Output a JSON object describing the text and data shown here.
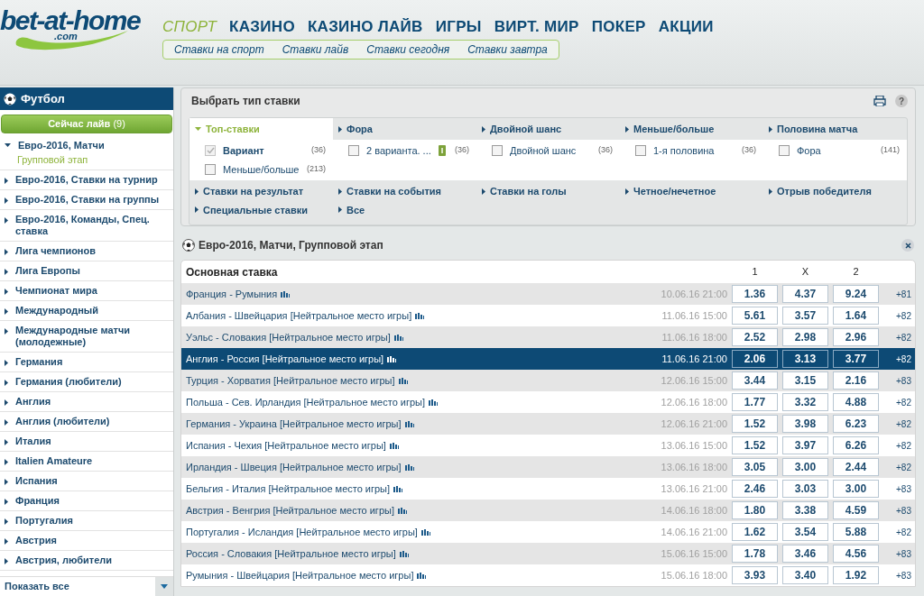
{
  "logo": {
    "name": "bet-at-home",
    "suffix": ".com"
  },
  "nav": [
    {
      "label": "СПОРТ",
      "selected": true
    },
    {
      "label": "КАЗИНО",
      "selected": false
    },
    {
      "label": "КАЗИНО ЛАЙВ",
      "selected": false
    },
    {
      "label": "ИГРЫ",
      "selected": false
    },
    {
      "label": "ВИРТ. МИР",
      "selected": false
    },
    {
      "label": "ПОКЕР",
      "selected": false
    },
    {
      "label": "АКЦИИ",
      "selected": false
    }
  ],
  "subnav": [
    "Ставки на спорт",
    "Ставки лайв",
    "Ставки сегодня",
    "Ставки завтра"
  ],
  "sidebar": {
    "title": "Футбол",
    "live_button": {
      "label": "Сейчас **лайв**",
      "count": "(9)"
    },
    "items": [
      {
        "label": "Евро-2016, Матчи",
        "expanded": true,
        "children": [
          {
            "label": "Групповой этап"
          }
        ]
      },
      {
        "label": "Евро-2016, Ставки на турнир",
        "expanded": false
      },
      {
        "label": "Евро-2016, Ставки на группы",
        "expanded": false
      },
      {
        "label": "Евро-2016, Команды, Спец. ставка",
        "expanded": false
      },
      {
        "label": "Лига чемпионов",
        "expanded": false
      },
      {
        "label": "Лига Европы",
        "expanded": false
      },
      {
        "label": "Чемпионат мира",
        "expanded": false
      },
      {
        "label": "Международный",
        "expanded": false
      },
      {
        "label": "Международные матчи (молодежные)",
        "expanded": false
      },
      {
        "label": "Германия",
        "expanded": false
      },
      {
        "label": "Германия (любители)",
        "expanded": false
      },
      {
        "label": "Англия",
        "expanded": false
      },
      {
        "label": "Англия (любители)",
        "expanded": false
      },
      {
        "label": "Италия",
        "expanded": false
      },
      {
        "label": "Italien Amateure",
        "expanded": false
      },
      {
        "label": "Испания",
        "expanded": false
      },
      {
        "label": "Франция",
        "expanded": false
      },
      {
        "label": "Португалия",
        "expanded": false
      },
      {
        "label": "Австрия",
        "expanded": false
      },
      {
        "label": "Австрия, любители",
        "expanded": false
      }
    ],
    "show_all": "Показать все"
  },
  "bet_types": {
    "title": "Выбрать тип ставки",
    "help": "?",
    "tabs": [
      {
        "label": "Топ-ставки",
        "selected": true
      },
      {
        "label": "Фора",
        "selected": false
      },
      {
        "label": "Двойной шанс",
        "selected": false
      },
      {
        "label": "Меньше/больше",
        "selected": false
      },
      {
        "label": "Половина матча",
        "selected": false
      }
    ],
    "options": [
      {
        "label": "Вариант",
        "count": "(36)",
        "checked": true
      },
      {
        "label": "2 варианта. ...",
        "badge": "I",
        "count": "(36)",
        "checked": false
      },
      {
        "label": "Двойной шанс",
        "count": "(36)",
        "checked": false
      },
      {
        "label": "1-я половина",
        "count": "(36)",
        "checked": false
      },
      {
        "label": "Фора",
        "count": "(141)",
        "checked": false
      },
      {
        "label": "Меньше/больше",
        "count": "(213)",
        "checked": false
      }
    ],
    "more_tabs": [
      {
        "label": "Ставки на результат",
        "selected": false
      },
      {
        "label": "Ставки на события",
        "selected": false
      },
      {
        "label": "Ставки на голы",
        "selected": false
      },
      {
        "label": "Четное/нечетное",
        "selected": false
      },
      {
        "label": "Отрыв победителя",
        "selected": false
      },
      {
        "label": "Специальные ставки",
        "selected": false
      },
      {
        "label": "Все",
        "selected": false
      }
    ]
  },
  "events": {
    "title": "Евро-2016, Матчи, Групповой этап",
    "market": "Основная ставка",
    "columns": [
      "1",
      "X",
      "2"
    ],
    "rows": [
      {
        "match": "Франция - Румыния",
        "date": "10.06.16 21:00",
        "odds": [
          "1.36",
          "4.37",
          "9.24"
        ],
        "more": "+81",
        "selected": false
      },
      {
        "match": "Албания - Швейцария [Нейтральное место игры]",
        "date": "11.06.16 15:00",
        "odds": [
          "5.61",
          "3.57",
          "1.64"
        ],
        "more": "+82",
        "selected": false
      },
      {
        "match": "Уэльс - Словакия [Нейтральное место игры]",
        "date": "11.06.16 18:00",
        "odds": [
          "2.52",
          "2.98",
          "2.96"
        ],
        "more": "+82",
        "selected": false
      },
      {
        "match": "Англия - Россия [Нейтральное место игры]",
        "date": "11.06.16 21:00",
        "odds": [
          "2.06",
          "3.13",
          "3.77"
        ],
        "more": "+82",
        "selected": true
      },
      {
        "match": "Турция - Хорватия [Нейтральное место игры]",
        "date": "12.06.16 15:00",
        "odds": [
          "3.44",
          "3.15",
          "2.16"
        ],
        "more": "+83",
        "selected": false
      },
      {
        "match": "Польша - Сев. Ирландия [Нейтральное место игры]",
        "date": "12.06.16 18:00",
        "odds": [
          "1.77",
          "3.32",
          "4.88"
        ],
        "more": "+82",
        "selected": false
      },
      {
        "match": "Германия - Украина [Нейтральное место игры]",
        "date": "12.06.16 21:00",
        "odds": [
          "1.52",
          "3.98",
          "6.23"
        ],
        "more": "+82",
        "selected": false
      },
      {
        "match": "Испания - Чехия [Нейтральное место игры]",
        "date": "13.06.16 15:00",
        "odds": [
          "1.52",
          "3.97",
          "6.26"
        ],
        "more": "+82",
        "selected": false
      },
      {
        "match": "Ирландия - Швеция [Нейтральное место игры]",
        "date": "13.06.16 18:00",
        "odds": [
          "3.05",
          "3.00",
          "2.44"
        ],
        "more": "+82",
        "selected": false
      },
      {
        "match": "Бельгия - Италия [Нейтральное место игры]",
        "date": "13.06.16 21:00",
        "odds": [
          "2.46",
          "3.03",
          "3.00"
        ],
        "more": "+83",
        "selected": false
      },
      {
        "match": "Австрия - Венгрия [Нейтральное место игры]",
        "date": "14.06.16 18:00",
        "odds": [
          "1.80",
          "3.38",
          "4.59"
        ],
        "more": "+83",
        "selected": false
      },
      {
        "match": "Португалия - Исландия [Нейтральное место игры]",
        "date": "14.06.16 21:00",
        "odds": [
          "1.62",
          "3.54",
          "5.88"
        ],
        "more": "+82",
        "selected": false
      },
      {
        "match": "Россия - Словакия [Нейтральное место игры]",
        "date": "15.06.16 15:00",
        "odds": [
          "1.78",
          "3.46",
          "4.56"
        ],
        "more": "+83",
        "selected": false
      },
      {
        "match": "Румыния - Швейцария [Нейтральное место игры]",
        "date": "15.06.16 18:00",
        "odds": [
          "3.93",
          "3.40",
          "1.92"
        ],
        "more": "+83",
        "selected": false
      }
    ]
  }
}
